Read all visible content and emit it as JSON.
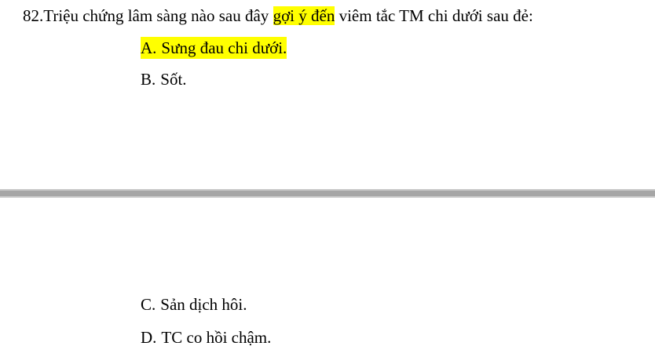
{
  "question": {
    "number": "82.",
    "text_before": "Triệu chứng lâm sàng nào sau đây ",
    "highlight": "gợi ý đến",
    "text_after": " viêm tắc TM chi dưới sau đẻ:"
  },
  "options": [
    {
      "letter": "A.",
      "text": "Sưng đau chi dưới.",
      "highlighted": true
    },
    {
      "letter": "B.",
      "text": "Sốt.",
      "highlighted": false
    },
    {
      "letter": "C.",
      "text": "Sản dịch hôi.",
      "highlighted": false
    },
    {
      "letter": "D.",
      "text": "TC co hồi chậm.",
      "highlighted": false
    }
  ],
  "colors": {
    "highlight": "#ffff00",
    "page_gap": "#a6a6a6"
  }
}
